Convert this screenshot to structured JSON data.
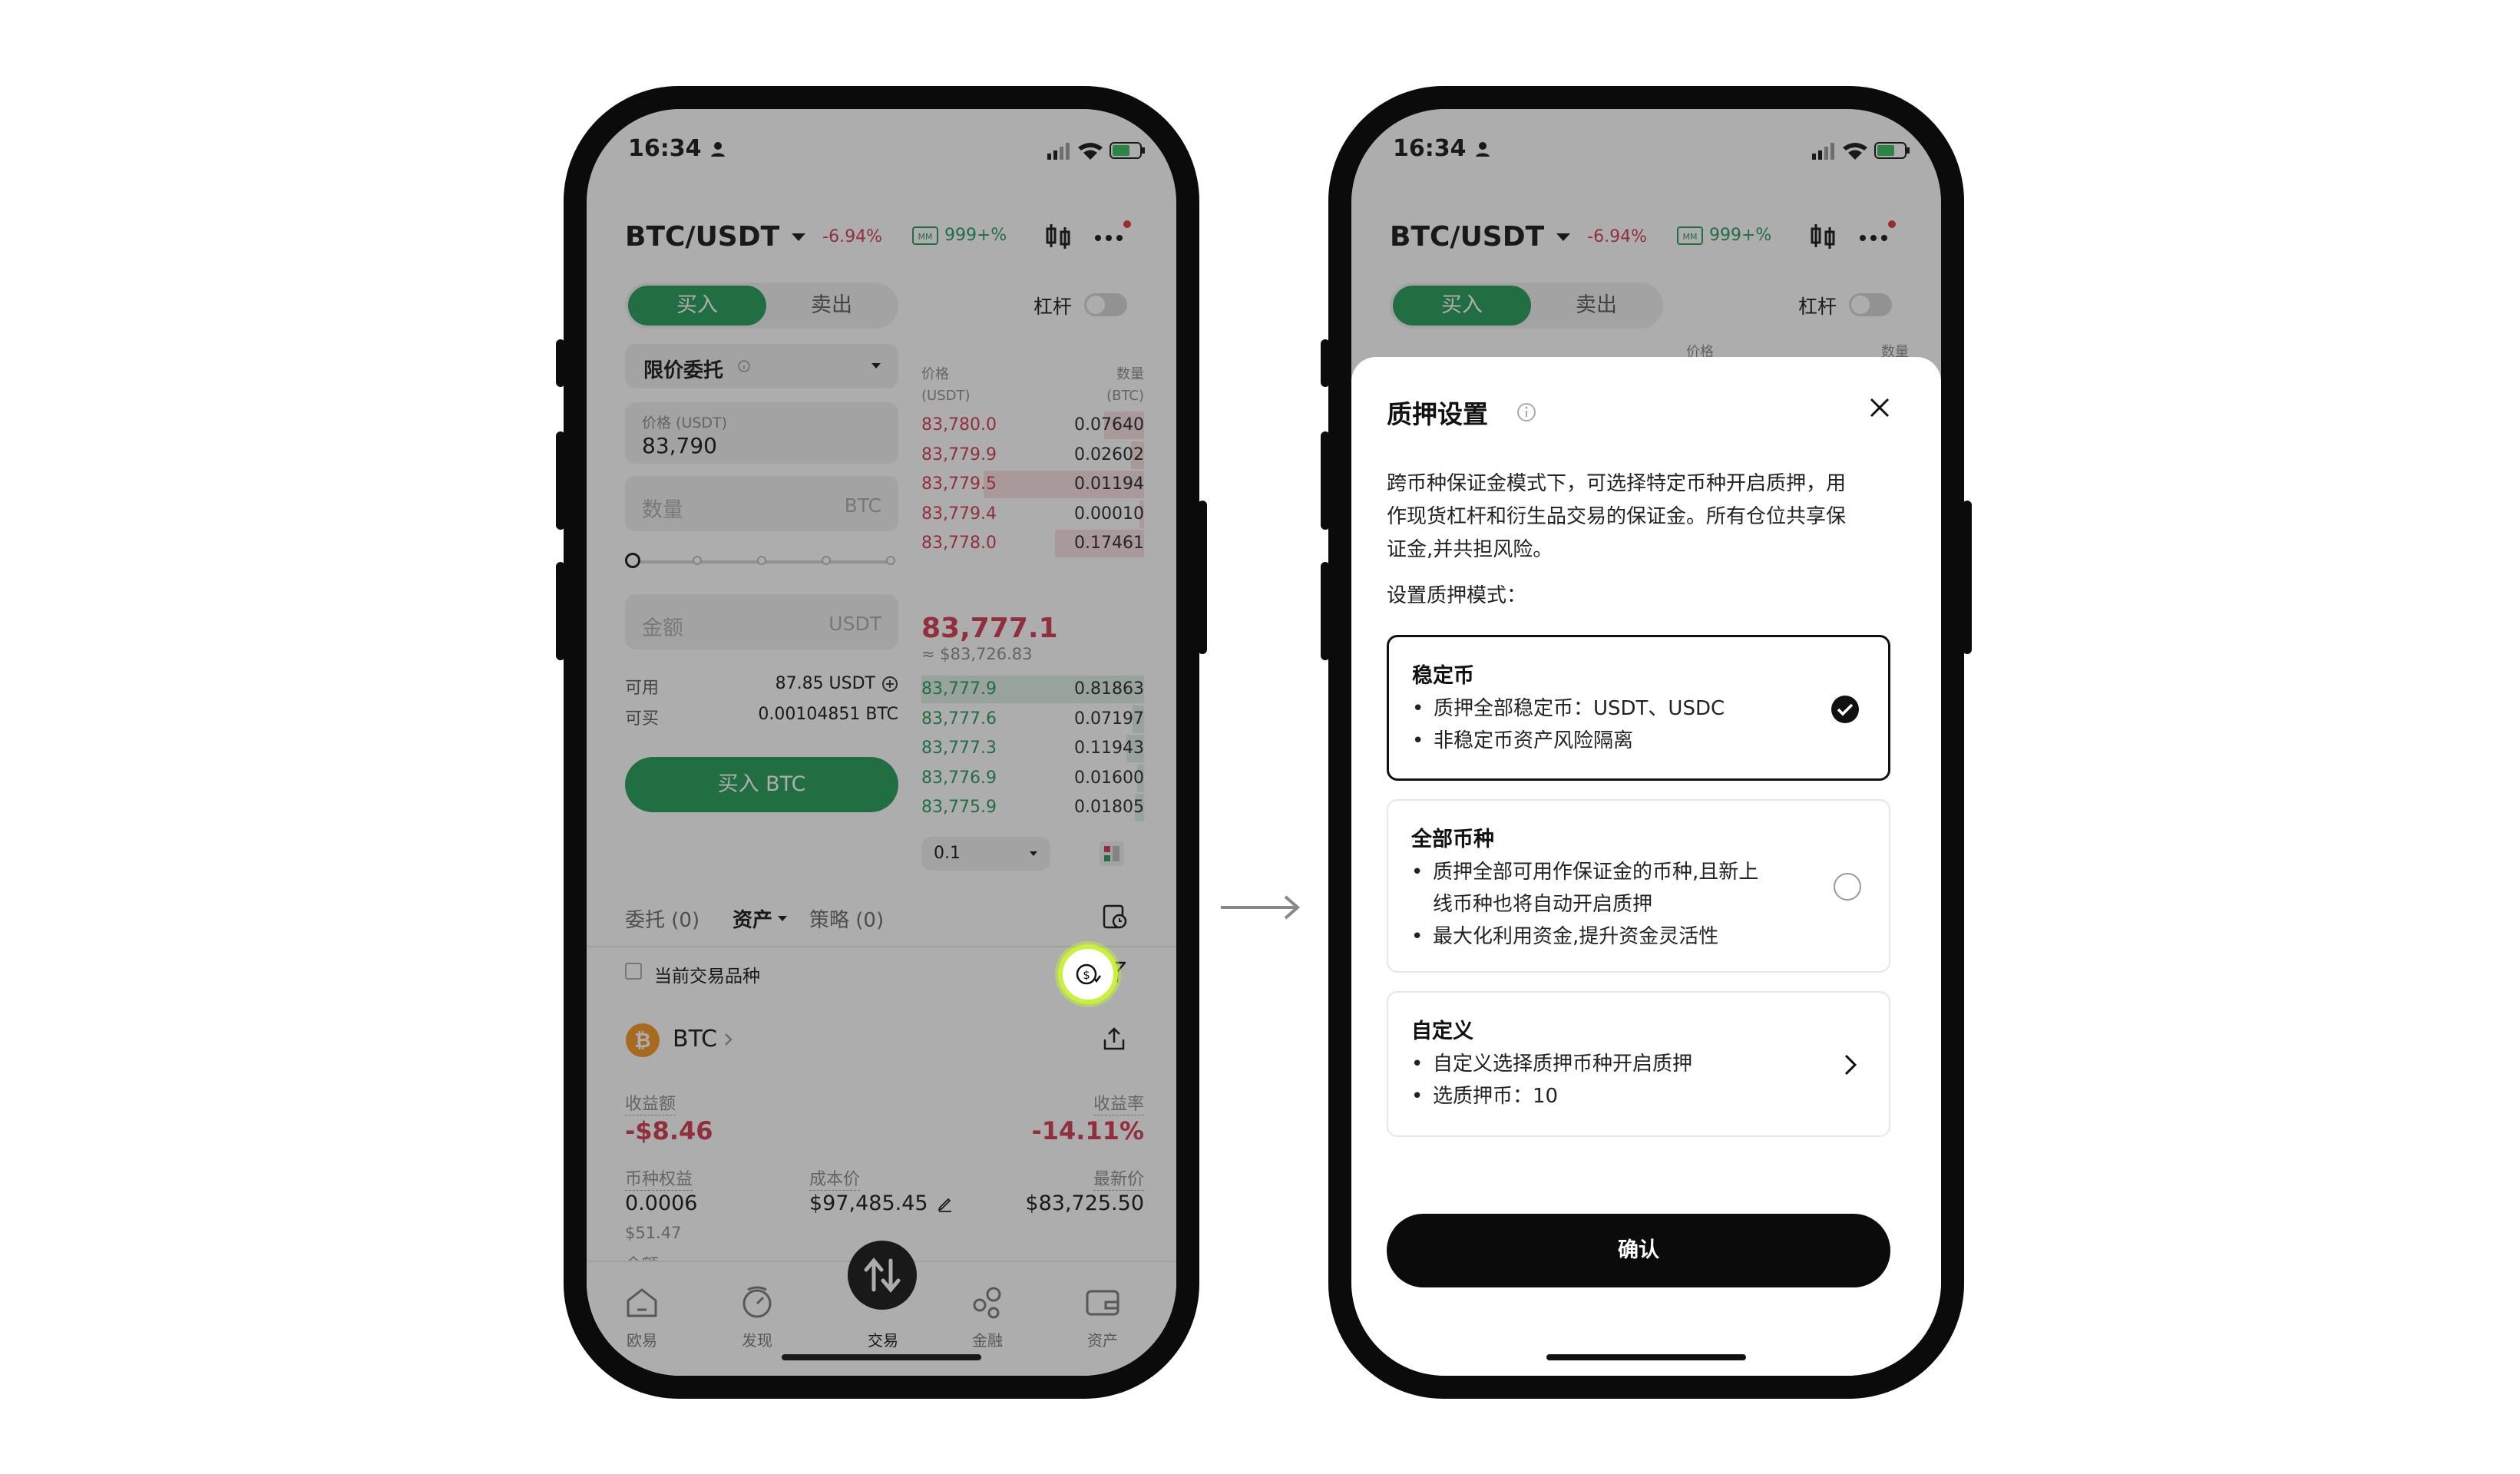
{
  "status": {
    "time": "16:34"
  },
  "left": {
    "pair": "BTC/USDT",
    "change": "-6.94%",
    "mm": "999+%",
    "buy_tab": "买入",
    "sell_tab": "卖出",
    "leverage": "杠杆",
    "order_type": "限价委托",
    "price_label": "价格 (USDT)",
    "price_value": "83,790",
    "qty_placeholder": "数量",
    "qty_unit": "BTC",
    "amount_placeholder": "金额",
    "amount_unit": "USDT",
    "available_label": "可用",
    "available_value": "87.85 USDT",
    "buyable_label": "可买",
    "buyable_value": "0.00104851 BTC",
    "buy_button": "买入 BTC",
    "ob_price_head": "价格\n(USDT)",
    "ob_price_head_1": "价格",
    "ob_price_head_2": "(USDT)",
    "ob_qty_head_1": "数量",
    "ob_qty_head_2": "(BTC)",
    "asks": [
      {
        "price": "83,780.0",
        "qty": "0.07640",
        "depth": 0.18
      },
      {
        "price": "83,779.9",
        "qty": "0.02602",
        "depth": 0.06
      },
      {
        "price": "83,779.5",
        "qty": "0.01194",
        "depth": 0.72
      },
      {
        "price": "83,779.4",
        "qty": "0.00010",
        "depth": 0.02
      },
      {
        "price": "83,778.0",
        "qty": "0.17461",
        "depth": 0.4
      }
    ],
    "last_price": "83,777.1",
    "last_price_fiat": "≈ $83,726.83",
    "bids": [
      {
        "price": "83,777.9",
        "qty": "0.81863",
        "depth": 1.0
      },
      {
        "price": "83,777.6",
        "qty": "0.07197",
        "depth": 0.05
      },
      {
        "price": "83,777.3",
        "qty": "0.11943",
        "depth": 0.08
      },
      {
        "price": "83,776.9",
        "qty": "0.01600",
        "depth": 0.03
      },
      {
        "price": "83,775.9",
        "qty": "0.01805",
        "depth": 0.04
      }
    ],
    "depth_select": "0.1",
    "tabs": [
      "委托 (0)",
      "资产",
      "策略 (0)"
    ],
    "current_pair_filter": "当前交易品种",
    "asset_name": "BTC",
    "pnl_label": "收益额",
    "pnl_value": "-$8.46",
    "pnl_rate_label": "收益率",
    "pnl_rate_value": "-14.11%",
    "equity_label": "币种权益",
    "equity_value": "0.0006",
    "equity_sub": "$51.47",
    "cost_label": "成本价",
    "cost_value": "$97,485.45",
    "last_label": "最新价",
    "last_value": "$83,725.50",
    "balance_label": "余额",
    "nav": [
      "欧易",
      "发现",
      "交易",
      "金融",
      "资产"
    ]
  },
  "right": {
    "title": "质押设置",
    "desc": "跨币种保证金模式下，可选择特定币种开启质押，用作现货杠杆和衍生品交易的保证金。所有仓位共享保证金,并共担风险。",
    "desc_1": "跨币种保证金模式下，可选择特定币种开启质押，用",
    "desc_2": "作现货杠杆和衍生品交易的保证金。所有仓位共享保",
    "desc_3": "证金,并共担风险。",
    "mode_label": "设置质押模式：",
    "options": [
      {
        "title": "稳定币",
        "lines": [
          "质押全部稳定币：USDT、USDC",
          "非稳定币资产风险隔离"
        ]
      },
      {
        "title": "全部币种",
        "lines": [
          "质押全部可用作保证金的币种,且新上",
          "线币种也将自动开启质押",
          "最大化利用资金,提升资金灵活性"
        ]
      },
      {
        "title": "自定义",
        "lines": [
          "自定义选择质押币种开启质押",
          "选质押币：10"
        ]
      }
    ],
    "confirm": "确认"
  },
  "colors": {
    "green": "#1f9a55",
    "red": "#d4354b",
    "highlight": "#c8f23a"
  }
}
